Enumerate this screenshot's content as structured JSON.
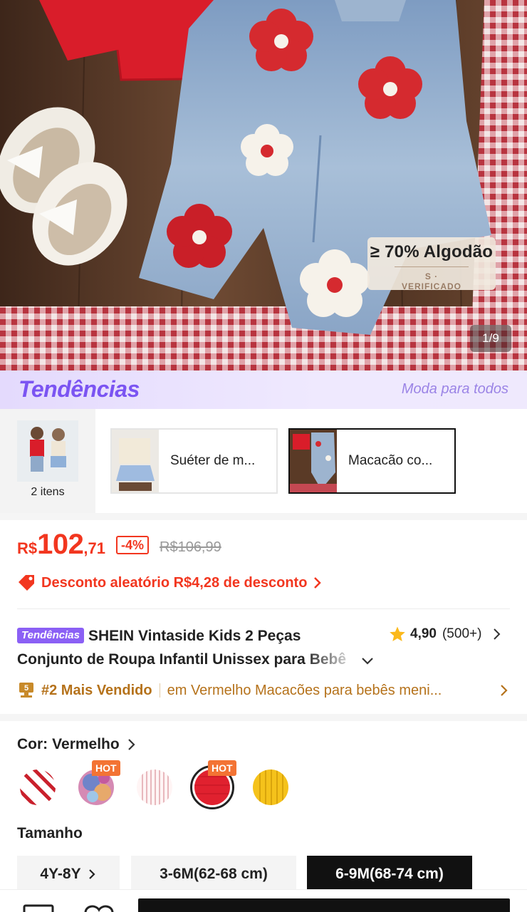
{
  "product_image": {
    "cotton_badge": {
      "main": "≥ 70% Algodão",
      "sub": "S · VERIFICADO"
    },
    "counter": "1/9"
  },
  "trends_banner": {
    "logo": "Tendências",
    "slogan": "Moda para todos"
  },
  "bundle": {
    "set_count": "2 itens",
    "items": [
      {
        "label": "Suéter de m..."
      },
      {
        "label": "Macacão co..."
      }
    ]
  },
  "price": {
    "currency": "R$",
    "integer": "102",
    "decimal": ",71",
    "discount_badge": "-4%",
    "original": "R$106,99",
    "promo": "Desconto aleatório R$4,28 de desconto"
  },
  "title": {
    "badge": "Tendências",
    "line1": "SHEIN Vintaside Kids 2 Peças",
    "line2": "Conjunto de Roupa Infantil Unissex para Bebê",
    "rating": "4,90",
    "review_count": "(500+)"
  },
  "bestseller": {
    "rank": "#2 Mais Vendido",
    "category": "em Vermelho Macacões para bebês meni..."
  },
  "color": {
    "label": "Cor:",
    "value": "Vermelho",
    "hot_badge": "HOT",
    "swatches": [
      "red-white-stripes",
      "multicolor-knit",
      "pink-white-stripes",
      "red",
      "yellow"
    ]
  },
  "size": {
    "label": "Tamanho",
    "options": [
      "4Y-8Y",
      "3-6M(62-68 cm)",
      "6-9M(68-74 cm)"
    ]
  },
  "colors": {
    "accent": "#f2361f",
    "trend_purple": "#7b54f2",
    "gold": "#b5721b"
  }
}
